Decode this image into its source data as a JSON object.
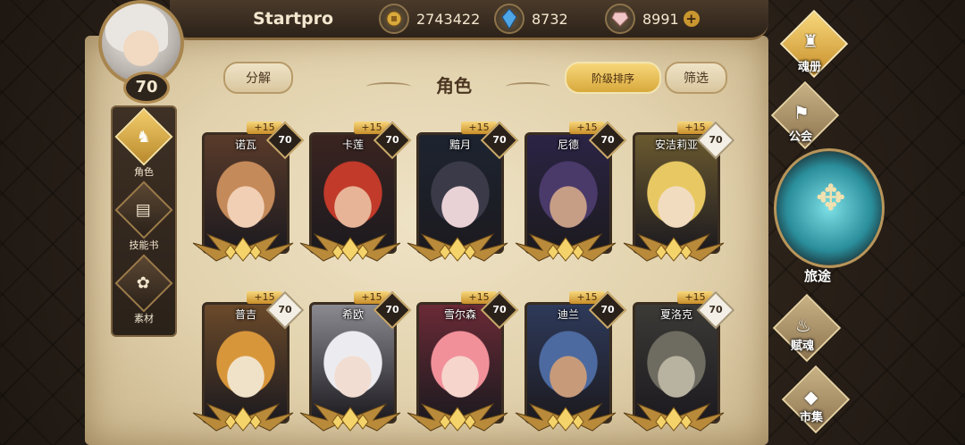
{
  "player": {
    "name": "Startpro",
    "level": "70"
  },
  "resources": [
    {
      "icon": "gold-coin-icon",
      "value": "2743422"
    },
    {
      "icon": "blue-crystal-icon",
      "value": "8732"
    },
    {
      "icon": "pink-gem-icon",
      "value": "8991"
    }
  ],
  "header": {
    "title": "角色",
    "decompose_label": "分解",
    "sort_label": "阶级排序",
    "filter_label": "筛选"
  },
  "left_menu": [
    {
      "label": "角色",
      "active": true
    },
    {
      "label": "技能书",
      "active": false
    },
    {
      "label": "素材",
      "active": false
    }
  ],
  "right_menu": {
    "soul_book": "魂册",
    "guild": "公会",
    "journey": "旅途",
    "endow_soul": "赋魂",
    "market": "市集"
  },
  "heroes": [
    {
      "name": "诺瓦",
      "bonus": "+15",
      "level": "70",
      "badge": "dark"
    },
    {
      "name": "卡莲",
      "bonus": "+15",
      "level": "70",
      "badge": "dark"
    },
    {
      "name": "黯月",
      "bonus": "+15",
      "level": "70",
      "badge": "dark"
    },
    {
      "name": "尼德",
      "bonus": "+15",
      "level": "70",
      "badge": "dark"
    },
    {
      "name": "安洁莉亚",
      "bonus": "+15",
      "level": "70",
      "badge": "white"
    },
    {
      "name": "普吉",
      "bonus": "+15",
      "level": "70",
      "badge": "white"
    },
    {
      "name": "希欧",
      "bonus": "+15",
      "level": "70",
      "badge": "dark"
    },
    {
      "name": "雪尔森",
      "bonus": "+15",
      "level": "70",
      "badge": "dark"
    },
    {
      "name": "迪兰",
      "bonus": "+15",
      "level": "70",
      "badge": "dark"
    },
    {
      "name": "夏洛克",
      "bonus": "+15",
      "level": "70",
      "badge": "white"
    }
  ],
  "colors": {
    "gold_accent": "#d8a93c",
    "parchment": "#e2d2ad",
    "frame_dark": "#2a2119"
  }
}
